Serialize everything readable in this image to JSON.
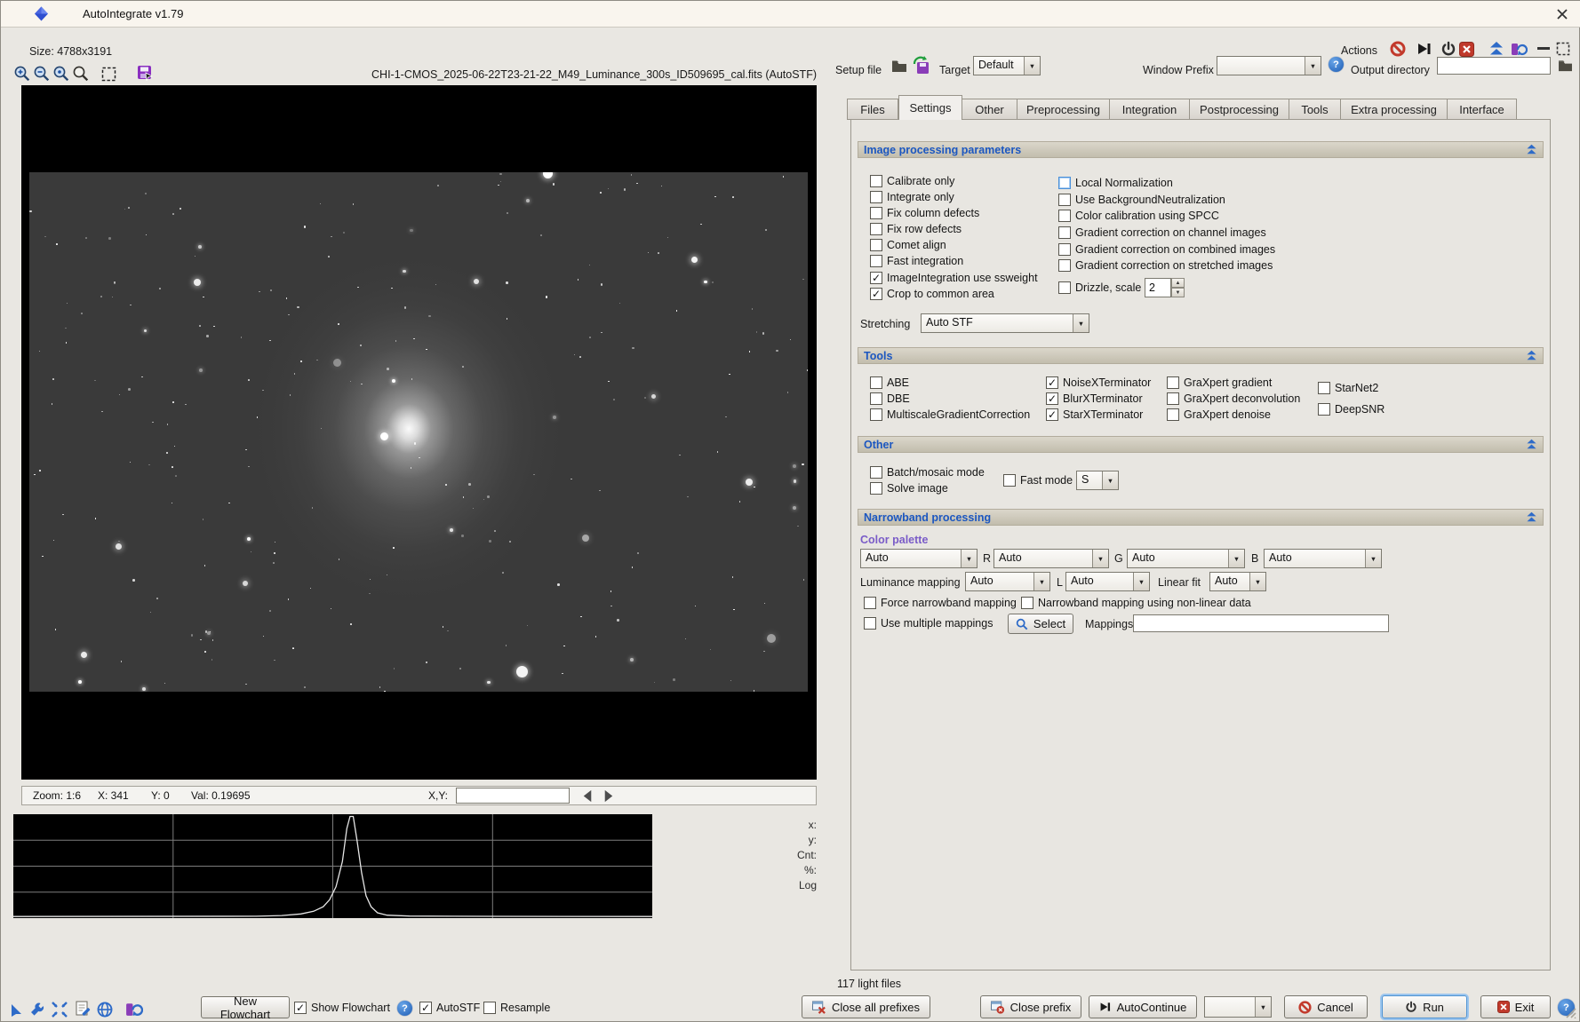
{
  "window": {
    "title": "AutoIntegrate v1.79",
    "size_label": "Size: 4788x3191",
    "actions_label": "Actions"
  },
  "toolbar": {
    "filename": "CHI-1-CMOS_2025-06-22T23-21-22_M49_Luminance_300s_ID509695_cal.fits (AutoSTF)"
  },
  "setup_row": {
    "setup_file_label": "Setup file",
    "target_label": "Target",
    "target_value": "Default",
    "window_prefix_label": "Window Prefix",
    "window_prefix_value": "",
    "output_directory_label": "Output directory",
    "output_directory_value": ""
  },
  "tabs": [
    {
      "label": "Files",
      "active": false
    },
    {
      "label": "Settings",
      "active": true
    },
    {
      "label": "Other",
      "active": false
    },
    {
      "label": "Preprocessing",
      "active": false
    },
    {
      "label": "Integration",
      "active": false
    },
    {
      "label": "Postprocessing",
      "active": false
    },
    {
      "label": "Tools",
      "active": false
    },
    {
      "label": "Extra processing",
      "active": false
    },
    {
      "label": "Interface",
      "active": false
    }
  ],
  "ipp": {
    "title": "Image processing parameters",
    "left": [
      {
        "label": "Calibrate only",
        "checked": false
      },
      {
        "label": "Integrate only",
        "checked": false
      },
      {
        "label": "Fix column defects",
        "checked": false
      },
      {
        "label": "Fix row defects",
        "checked": false
      },
      {
        "label": "Comet align",
        "checked": false
      },
      {
        "label": "Fast integration",
        "checked": false
      },
      {
        "label": "ImageIntegration use ssweight",
        "checked": true
      },
      {
        "label": "Crop to common area",
        "checked": true
      }
    ],
    "right": [
      {
        "label": "Local Normalization",
        "checked": false,
        "focused": true
      },
      {
        "label": "Use BackgroundNeutralization",
        "checked": false
      },
      {
        "label": "Color calibration using SPCC",
        "checked": false
      },
      {
        "label": "Gradient correction on channel images",
        "checked": false
      },
      {
        "label": "Gradient correction on combined images",
        "checked": false
      },
      {
        "label": "Gradient correction on stretched images",
        "checked": false
      }
    ],
    "drizzle": {
      "label": "Drizzle, scale",
      "checked": false,
      "value": "2"
    },
    "stretching_label": "Stretching",
    "stretching_value": "Auto STF"
  },
  "tools_section": {
    "title": "Tools",
    "col1": [
      {
        "label": "ABE",
        "checked": false
      },
      {
        "label": "DBE",
        "checked": false
      },
      {
        "label": "MultiscaleGradientCorrection",
        "checked": false
      }
    ],
    "col2": [
      {
        "label": "NoiseXTerminator",
        "checked": true
      },
      {
        "label": "BlurXTerminator",
        "checked": true
      },
      {
        "label": "StarXTerminator",
        "checked": true
      }
    ],
    "col3": [
      {
        "label": "GraXpert gradient",
        "checked": false
      },
      {
        "label": "GraXpert deconvolution",
        "checked": false
      },
      {
        "label": "GraXpert denoise",
        "checked": false
      }
    ],
    "col4": [
      {
        "label": "StarNet2",
        "checked": false
      },
      {
        "label": "DeepSNR",
        "checked": false
      }
    ]
  },
  "other_section": {
    "title": "Other",
    "batch": {
      "label": "Batch/mosaic mode",
      "checked": false
    },
    "solve": {
      "label": "Solve image",
      "checked": false
    },
    "fast_mode": {
      "label": "Fast mode",
      "checked": false,
      "value": "S"
    }
  },
  "narrowband": {
    "title": "Narrowband processing",
    "color_palette_label": "Color palette",
    "palette_value": "Auto",
    "r_label": "R",
    "r_value": "Auto",
    "g_label": "G",
    "g_value": "Auto",
    "b_label": "B",
    "b_value": "Auto",
    "luminance_mapping_label": "Luminance mapping",
    "luminance_value": "Auto",
    "l_label": "L",
    "l_value": "Auto",
    "linear_fit_label": "Linear fit",
    "linear_fit_value": "Auto",
    "force_mapping": {
      "label": "Force narrowband mapping",
      "checked": false
    },
    "nonlinear_mapping": {
      "label": "Narrowband mapping using non-linear data",
      "checked": false
    },
    "multiple_mappings": {
      "label": "Use multiple mappings",
      "checked": false
    },
    "select_button": "Select",
    "mappings_label": "Mappings",
    "mappings_value": ""
  },
  "image_status": {
    "tokens": [
      "Zoom: 1:6",
      "X: 341",
      "Y: 0",
      "Val: 0.19695"
    ],
    "xy_label": "X,Y:",
    "xy_value": ""
  },
  "histogram_panel": {
    "labels": [
      "x:",
      "y:",
      "Cnt:",
      "%:",
      "Log"
    ],
    "curve": [
      [
        0,
        0.003
      ],
      [
        0.38,
        0.005
      ],
      [
        0.42,
        0.012
      ],
      [
        0.45,
        0.028
      ],
      [
        0.47,
        0.055
      ],
      [
        0.485,
        0.1
      ],
      [
        0.495,
        0.17
      ],
      [
        0.505,
        0.3
      ],
      [
        0.515,
        0.55
      ],
      [
        0.522,
        0.88
      ],
      [
        0.527,
        1.0
      ],
      [
        0.532,
        1.0
      ],
      [
        0.538,
        0.76
      ],
      [
        0.545,
        0.44
      ],
      [
        0.552,
        0.21
      ],
      [
        0.56,
        0.1
      ],
      [
        0.57,
        0.04
      ],
      [
        0.585,
        0.016
      ],
      [
        0.62,
        0.007
      ],
      [
        0.75,
        0.004
      ],
      [
        1,
        0.003
      ]
    ]
  },
  "footer": {
    "light_files": "117 light files",
    "close_all_prefixes": "Close all prefixes",
    "close_prefix": "Close prefix",
    "autocontinue": "AutoContinue",
    "prefix_value": "",
    "cancel": "Cancel",
    "run": "Run",
    "exit": "Exit"
  },
  "flowchart_bar": {
    "new_flowchart": "New Flowchart",
    "show_flowchart": {
      "label": "Show Flowchart",
      "checked": true
    },
    "autostf": {
      "label": "AutoSTF",
      "checked": true
    },
    "resample": {
      "label": "Resample",
      "checked": false
    }
  },
  "colors": {
    "section_title": "#1c57c0",
    "color_palette_title": "#7a5cc8",
    "danger_red": "#c0392b",
    "accent_blue": "#2e6bc8",
    "titlebar_bg": "#f9f5ee",
    "window_bg": "#e9e7e2"
  }
}
